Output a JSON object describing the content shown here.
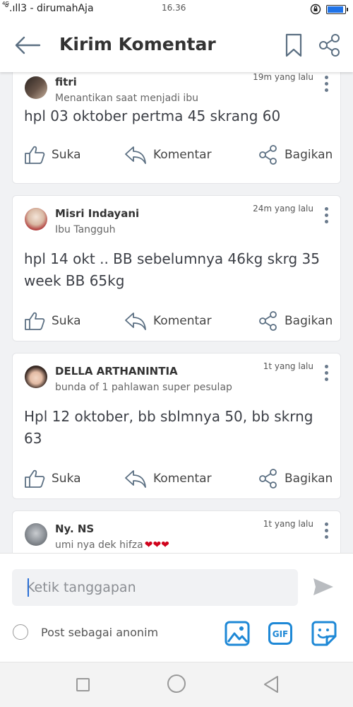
{
  "status_bar": {
    "network_tag": "4G",
    "carrier": "°.ıll3 - dirumahAja",
    "time": "16.36",
    "battery_level": 0.9
  },
  "app_bar": {
    "title": "Kirim Komentar",
    "icons": [
      "back-arrow-icon",
      "bookmark-icon",
      "share-icon"
    ]
  },
  "posts": [
    {
      "user": "fitri",
      "tagline": "Menantikan saat menjadi ibu",
      "time": "19m yang lalu",
      "text": "hpl 03 oktober pertma 45 skrang 60",
      "like": "Suka",
      "comment": "Komentar",
      "share": "Bagikan"
    },
    {
      "user": "Misri Indayani",
      "tagline": "Ibu Tangguh",
      "time": "24m yang lalu",
      "text": "hpl 14 okt .. BB sebelumnya 46kg skrg 35 week BB 65kg",
      "like": "Suka",
      "comment": "Komentar",
      "share": "Bagikan"
    },
    {
      "user": "DELLA ARTHANINTIA",
      "tagline": "bunda of 1 pahlawan super pesulap",
      "time": "1t yang lalu",
      "text": "Hpl 12 oktober, bb sblmnya 50, bb skrng 63",
      "like": "Suka",
      "comment": "Komentar",
      "share": "Bagikan"
    },
    {
      "user": "Ny. NS",
      "tagline": "umi nya dek hifza",
      "tagline_emoji": "❤❤❤",
      "time": "1t yang lalu"
    }
  ],
  "composer": {
    "placeholder": "Ketik tanggapan",
    "anon_label": "Post sebagai anonim",
    "gif_label": "GIF"
  },
  "colors": {
    "accent_blue": "#1e88d6",
    "heart_red": "#d0021b",
    "text_dark": "#3c3f46"
  }
}
